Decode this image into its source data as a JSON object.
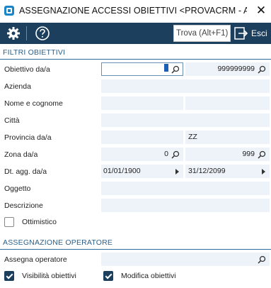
{
  "window": {
    "title": "ASSEGNAZIONE ACCESSI OBIETTIVI <PROVACRM - AZIEND...",
    "close_glyph": "✕"
  },
  "toolbar": {
    "search_placeholder": "Trova (Alt+F1)",
    "exit_label": "Esci",
    "icons": [
      "gear-icon",
      "help-icon",
      "exit-icon"
    ]
  },
  "filters": {
    "section_title": "FILTRI OBIETTIVI",
    "rows": {
      "obiettivo": {
        "label": "Obiettivo da/a",
        "from": "",
        "to": "999999999"
      },
      "azienda": {
        "label": "Azienda",
        "value": ""
      },
      "nome": {
        "label": "Nome e cognome",
        "first": "",
        "second": ""
      },
      "citta": {
        "label": "Città",
        "value": ""
      },
      "provincia": {
        "label": "Provincia da/a",
        "from": "",
        "to": "ZZ"
      },
      "zona": {
        "label": "Zona da/a",
        "from": "0",
        "to": "999"
      },
      "dt_agg": {
        "label": "Dt. agg. da/a",
        "from": "01/01/1900",
        "to": "31/12/2099"
      },
      "oggetto": {
        "label": "Oggetto",
        "value": ""
      },
      "descrizione": {
        "label": "Descrizione",
        "value": ""
      },
      "ottimistico": {
        "label": "Ottimistico",
        "checked": false
      }
    }
  },
  "assignment": {
    "section_title": "ASSEGNAZIONE OPERATORE",
    "operator": {
      "label": "Assegna operatore",
      "value": ""
    },
    "visibility": {
      "label": "Visibilità obiettivi",
      "checked": true
    },
    "modify": {
      "label": "Modifica obiettivi",
      "checked": true
    }
  },
  "colors": {
    "toolbar_bg": "#1b3f5c",
    "section_text": "#2a5f8a",
    "field_bg": "#eef3f9"
  }
}
